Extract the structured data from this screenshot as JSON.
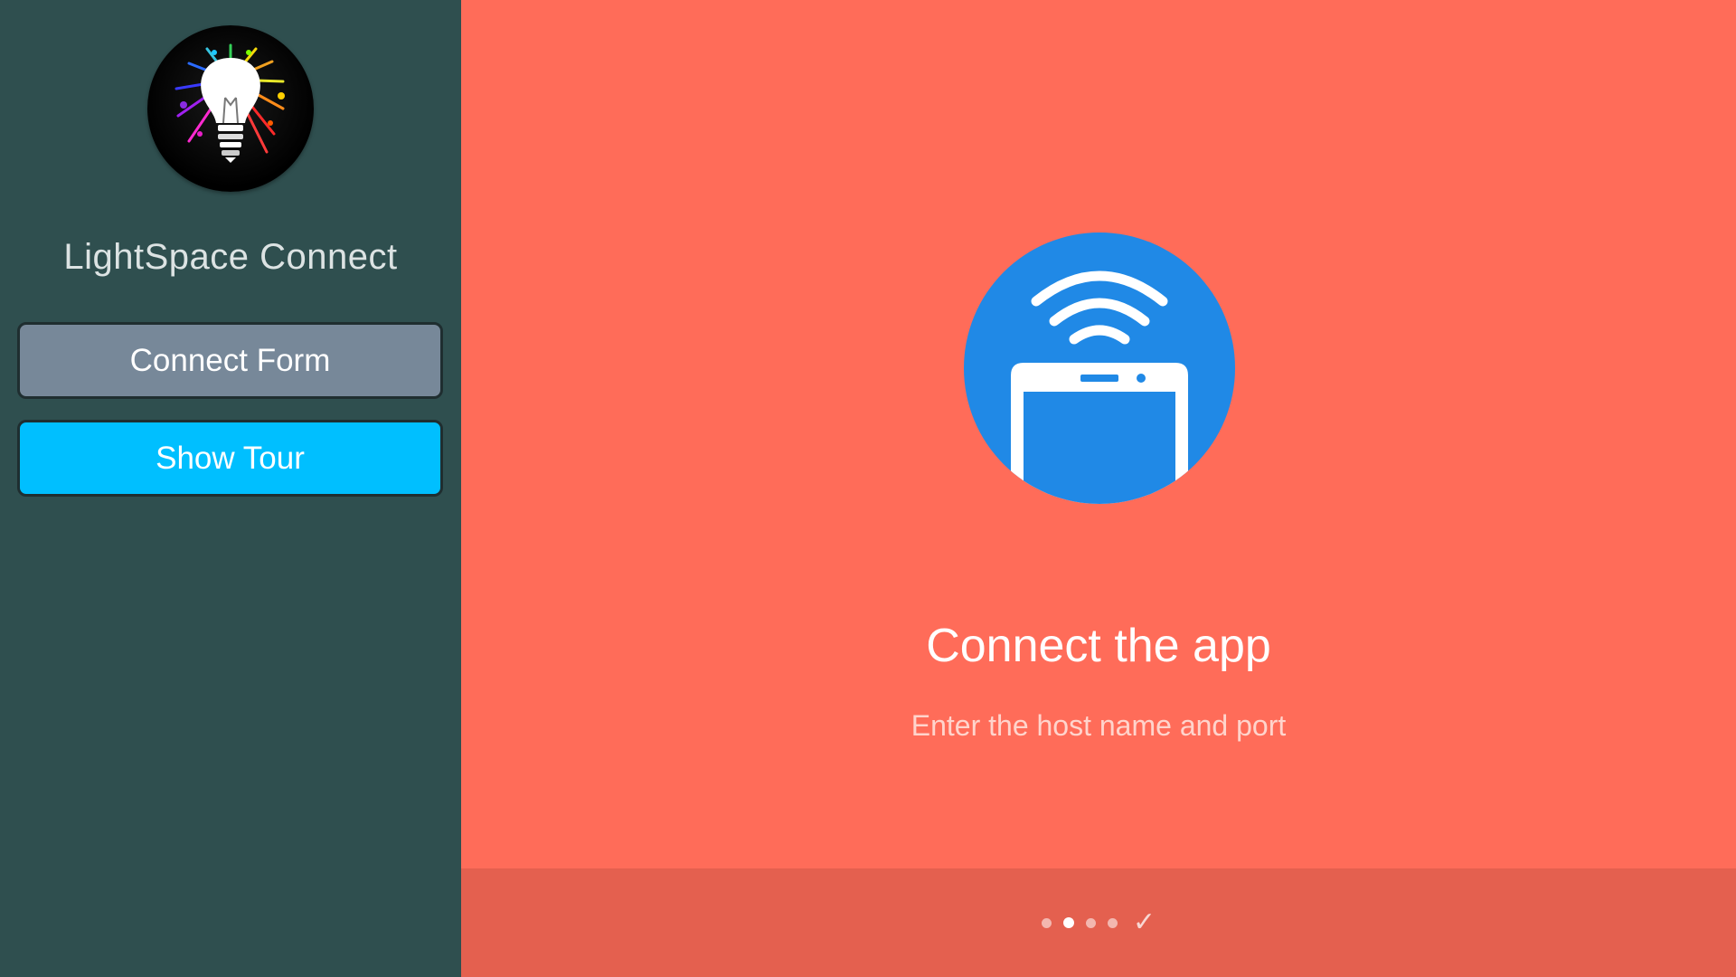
{
  "sidebar": {
    "app_title": "LightSpace Connect",
    "logo_icon": "lightbulb-paint-splash-icon",
    "buttons": {
      "connect_form": "Connect Form",
      "show_tour": "Show Tour"
    }
  },
  "tour": {
    "hero_icon": "phone-wifi-icon",
    "title": "Connect the app",
    "subtitle": "Enter the host name and port",
    "page_count": 4,
    "active_page": 2,
    "done_symbol": "✓"
  },
  "colors": {
    "sidebar_bg": "#2f4f4f",
    "connect_button": "#778899",
    "tour_button": "#00bfff",
    "tour_bg": "#ff6c59",
    "bottom_bar": "#e4604f",
    "hero_circle": "#2089e6"
  }
}
